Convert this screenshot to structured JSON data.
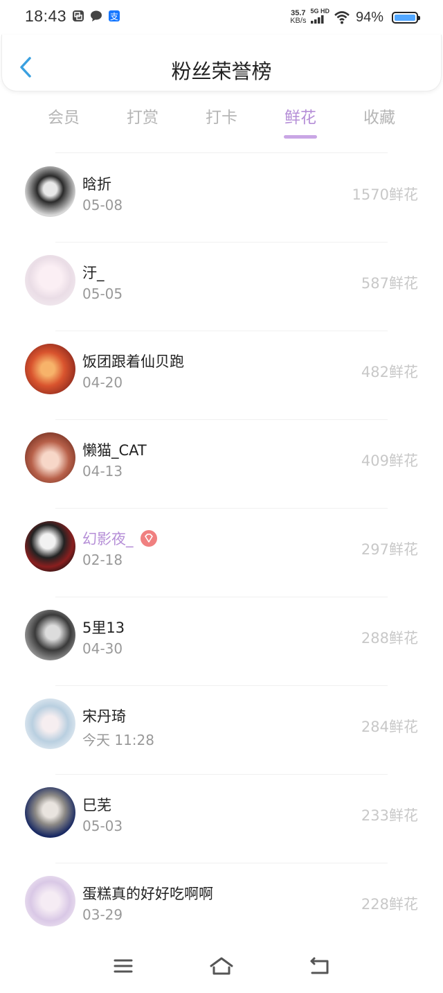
{
  "status_bar": {
    "time": "18:43",
    "net_speed_value": "35.7",
    "net_speed_unit": "KB/s",
    "network": "5G HD",
    "battery": "94%",
    "icons": [
      "gallery-notification-icon",
      "chat-notification-icon",
      "alipay-notification-icon",
      "signal-icon",
      "wifi-icon",
      "battery-icon"
    ]
  },
  "header": {
    "title": "粉丝荣誉榜",
    "back_icon": "chevron-left-icon"
  },
  "tabs": [
    {
      "label": "会员",
      "active": false
    },
    {
      "label": "打赏",
      "active": false
    },
    {
      "label": "打卡",
      "active": false
    },
    {
      "label": "鲜花",
      "active": true
    },
    {
      "label": "收藏",
      "active": false
    }
  ],
  "fans": [
    {
      "name": "晗折",
      "date": "05-08",
      "count": "1570鲜花",
      "vip": false
    },
    {
      "name": "汙_",
      "date": "05-05",
      "count": "587鲜花",
      "vip": false
    },
    {
      "name": "饭团跟着仙贝跑",
      "date": "04-20",
      "count": "482鲜花",
      "vip": false
    },
    {
      "name": "懒猫_CAT",
      "date": "04-13",
      "count": "409鲜花",
      "vip": false
    },
    {
      "name": "幻影夜_",
      "date": "02-18",
      "count": "297鲜花",
      "vip": true
    },
    {
      "name": "5里13",
      "date": "04-30",
      "count": "288鲜花",
      "vip": false
    },
    {
      "name": "宋丹琦",
      "date": "今天 11:28",
      "count": "284鲜花",
      "vip": false
    },
    {
      "name": "巳芜",
      "date": "05-03",
      "count": "233鲜花",
      "vip": false
    },
    {
      "name": "蛋糕真的好好吃啊啊",
      "date": "03-29",
      "count": "228鲜花",
      "vip": false
    }
  ],
  "colors": {
    "accent": "#b58ed7",
    "back_arrow": "#3aa0e0",
    "count_text": "#c8c8c8",
    "date_text": "#999999"
  },
  "nav_bar": {
    "icons": [
      "menu-icon",
      "home-icon",
      "back-icon"
    ]
  }
}
